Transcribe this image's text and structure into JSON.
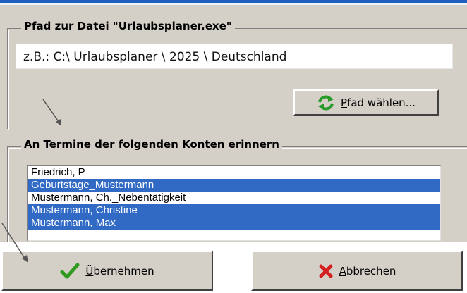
{
  "path_group": {
    "title": "Pfad zur Datei \"Urlaubsplaner.exe\"",
    "path_value": "z.B.:  C:\\ Urlaubsplaner \\ 2025 \\ Deutschland",
    "choose_button": {
      "mnemonic": "P",
      "rest": "fad wählen...",
      "icon": "refresh-icon"
    }
  },
  "accounts_group": {
    "title": "An Termine der folgenden Konten erinnern",
    "items": [
      {
        "label": "Friedrich, P",
        "selected": false
      },
      {
        "label": "Geburtstage_Mustermann",
        "selected": true
      },
      {
        "label": "Mustermann, Ch._Nebentätigkeit",
        "selected": false
      },
      {
        "label": "Mustermann, Christine",
        "selected": true
      },
      {
        "label": "Mustermann, Max",
        "selected": true
      }
    ]
  },
  "buttons": {
    "ok": {
      "mnemonic": "Ü",
      "rest": "bernehmen",
      "icon": "checkmark-icon"
    },
    "cancel": {
      "mnemonic": "A",
      "rest": "bbrechen",
      "icon": "cross-icon"
    }
  },
  "colors": {
    "selection": "#316ac5",
    "dialog_bg": "#d4d0c8",
    "check": "#2e9a1e",
    "cross": "#d42020"
  }
}
